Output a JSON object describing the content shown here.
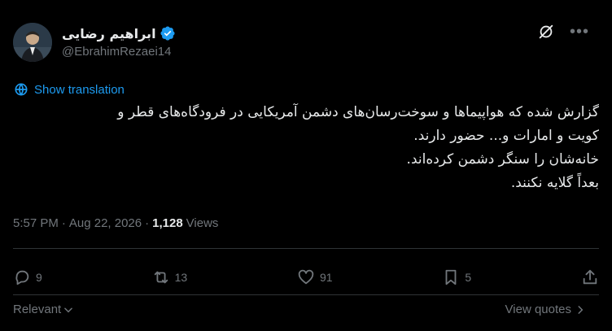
{
  "author": {
    "display_name": "ابراهیم رضایی",
    "handle": "@EbrahimRezaei14"
  },
  "icons": {
    "verified": "verified-badge-icon",
    "grok": "grok-icon",
    "more": "more-icon",
    "translate": "globe-icon",
    "reply": "reply-icon",
    "repost": "repost-icon",
    "like": "heart-icon",
    "bookmark": "bookmark-icon",
    "share": "share-icon"
  },
  "colors": {
    "accent": "#1d9bf0",
    "muted": "#71767b",
    "text": "#e7e9ea",
    "background": "#000000"
  },
  "translation_label": "Show translation",
  "tweet_lines": [
    "گزارش شده که هواپیماها و سوخت‌رسان‌های دشمن آمریکایی در فرودگاه‌های قطر و",
    "کویت و امارات و... حضور دارند.",
    "خانه‌شان را سنگر دشمن کرده‌اند.",
    "بعداً گلایه نکنند."
  ],
  "meta": {
    "time": "5:57 PM",
    "separator": "·",
    "date": "Aug 22, 2026",
    "views_count": "1,128",
    "views_label": "Views"
  },
  "actions": {
    "replies": "9",
    "reposts": "13",
    "likes": "91",
    "bookmarks": "5"
  },
  "footer": {
    "sort_label": "Relevant",
    "view_quotes": "View quotes"
  }
}
